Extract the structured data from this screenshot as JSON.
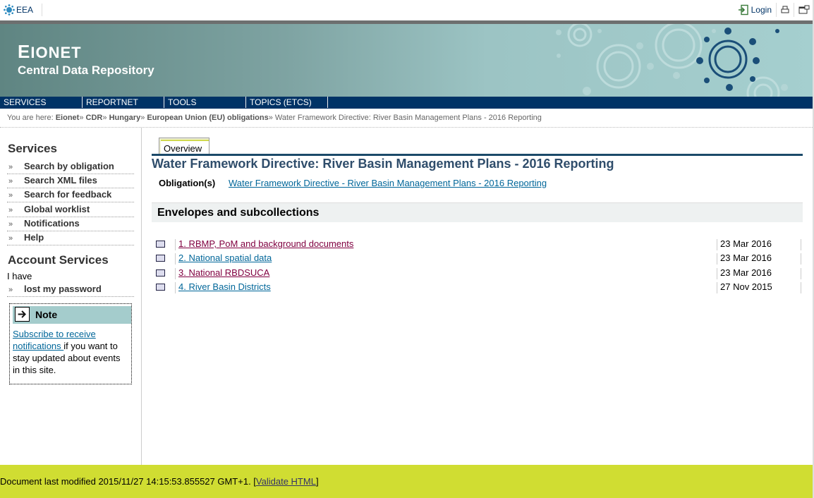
{
  "topbar": {
    "eea_label": "EEA",
    "login_label": "Login"
  },
  "header": {
    "title_first": "E",
    "title_rest": "IONET",
    "subtitle": "Central Data Repository"
  },
  "menu": {
    "items": [
      "SERVICES",
      "REPORTNET",
      "TOOLS",
      "TOPICS (ETCS)"
    ]
  },
  "breadcrumb": {
    "prefix": "You are here:",
    "items": [
      "Eionet",
      "CDR",
      "Hungary",
      "European Union (EU) obligations"
    ],
    "current": "Water Framework Directive: River Basin Management Plans - 2016 Reporting"
  },
  "sidebar": {
    "services_heading": "Services",
    "services": [
      "Search by obligation",
      "Search XML files",
      "Search for feedback",
      "Global worklist",
      "Notifications",
      "Help"
    ],
    "account_heading": "Account Services",
    "i_have": "I have",
    "lost_password": "lost my password",
    "note": {
      "title": "Note",
      "link_text": "Subscribe to receive notifications ",
      "rest_text": "if you want to stay updated about events in this site."
    }
  },
  "main": {
    "tab_label": "Overview",
    "title": "Water Framework Directive: River Basin Management Plans - 2016 Reporting",
    "obligation_label": "Obligation(s)",
    "obligation_link": "Water Framework Directive - River Basin Management Plans - 2016 Reporting",
    "envelopes_heading": "Envelopes and subcollections",
    "envelopes": [
      {
        "title": "1. RBMP, PoM and background documents",
        "date": "23 Mar 2016",
        "visited": true
      },
      {
        "title": "2. National spatial data",
        "date": "23 Mar 2016",
        "visited": false
      },
      {
        "title": "3. National RBDSUCA",
        "date": "23 Mar 2016",
        "visited": true
      },
      {
        "title": "4. River Basin Districts",
        "date": "27 Nov 2015",
        "visited": false
      }
    ]
  },
  "footer": {
    "text": "Document last modified 2015/11/27 14:15:53.855527 GMT+1. [",
    "link": "Validate HTML",
    "close": "]"
  },
  "colors": {
    "menu_bg": "#003366",
    "footer_bg": "#d0dd32",
    "link": "#006699",
    "visited": "#800040",
    "title": "#2f4d6b"
  }
}
